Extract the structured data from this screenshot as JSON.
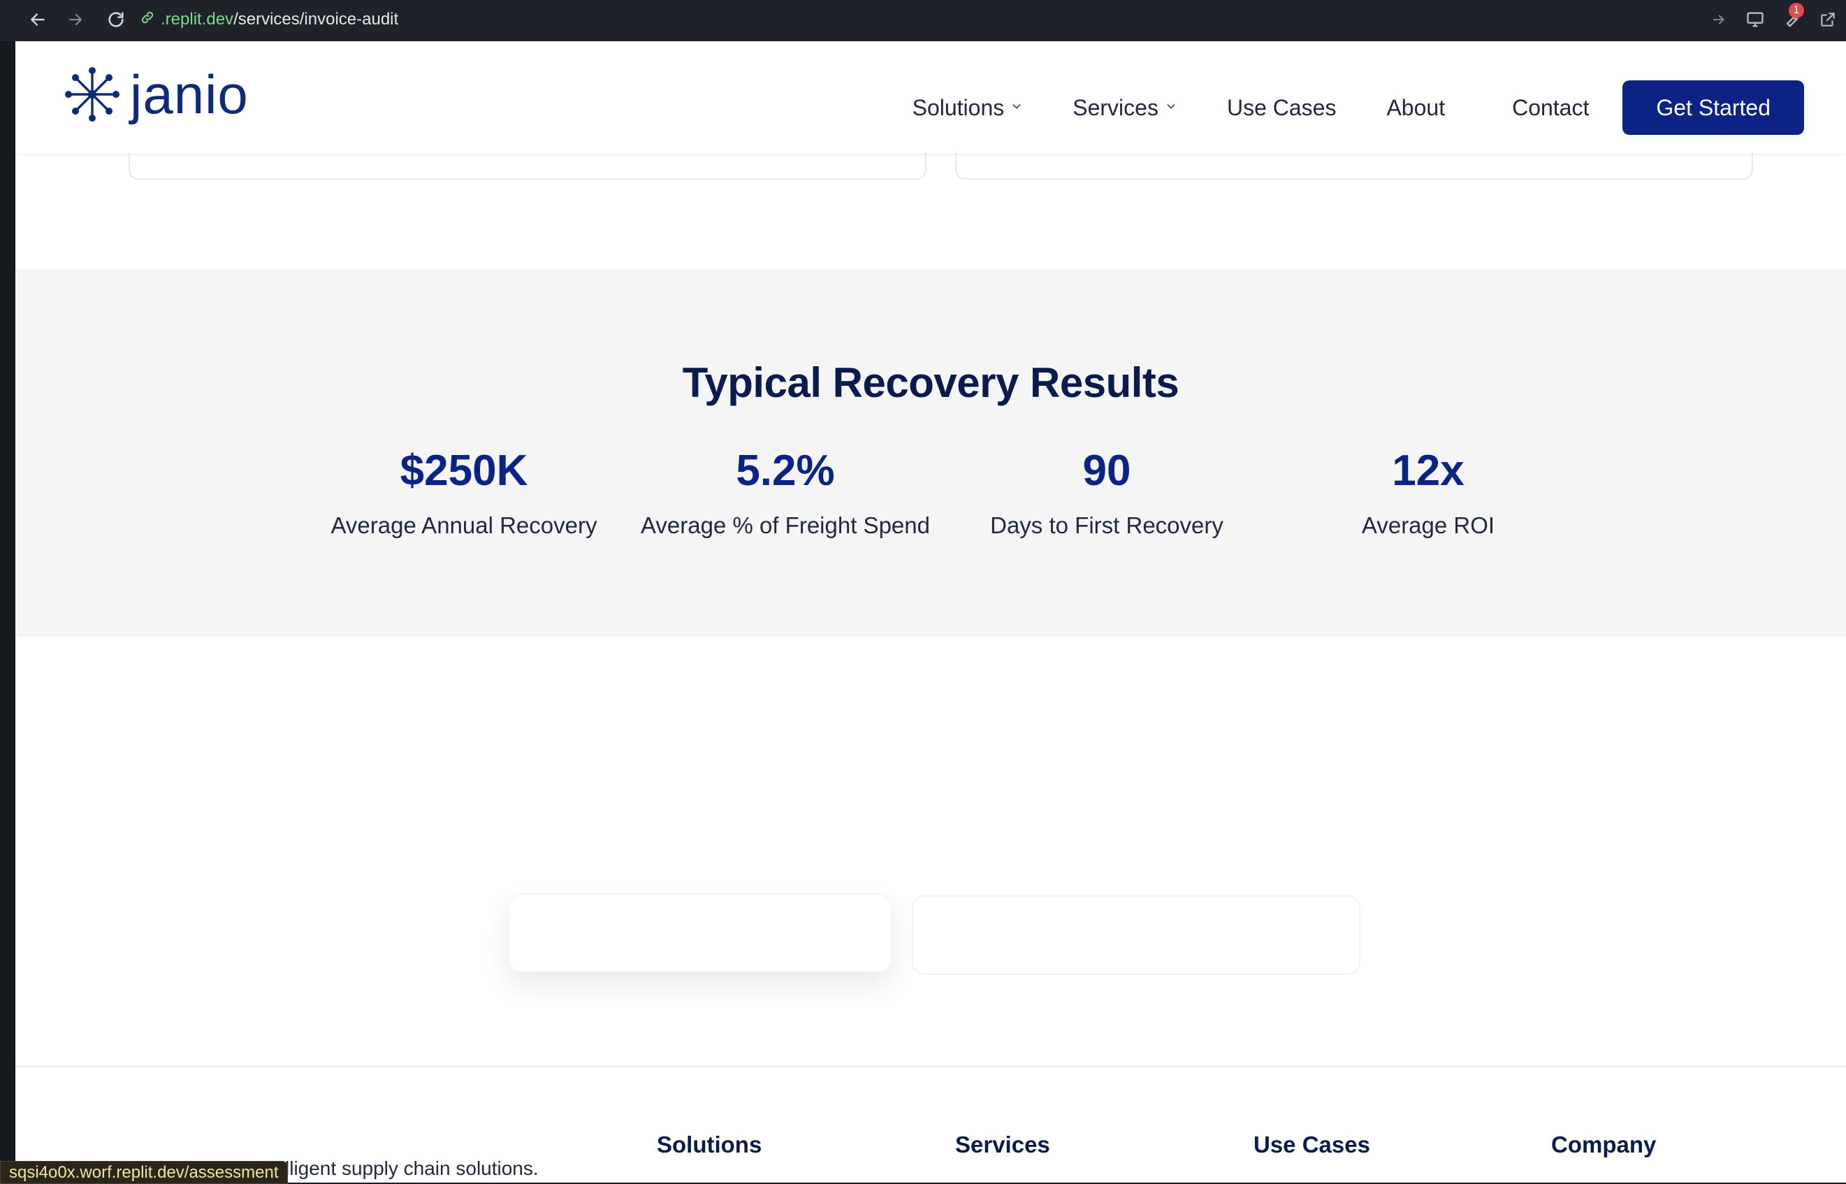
{
  "browser": {
    "url_domain": ".replit.dev",
    "url_path": "/services/invoice-audit",
    "badge_count": "1",
    "status_link": "sqsi4o0x.worf.replit.dev/assessment"
  },
  "header": {
    "logo_text": "janio",
    "nav": [
      {
        "label": "Solutions",
        "has_dropdown": true
      },
      {
        "label": "Services",
        "has_dropdown": true
      },
      {
        "label": "Use Cases",
        "has_dropdown": false
      },
      {
        "label": "About",
        "has_dropdown": false
      },
      {
        "label": "Contact",
        "has_dropdown": false
      }
    ],
    "cta_label": "Get Started",
    "brand_color": "#0b2384"
  },
  "results": {
    "title": "Typical Recovery Results",
    "stats": [
      {
        "value": "$250K",
        "label": "Average Annual Recovery"
      },
      {
        "value": "5.2%",
        "label": "Average % of Freight Spend"
      },
      {
        "value": "90",
        "label": "Days to First Recovery"
      },
      {
        "value": "12x",
        "label": "Average ROI"
      }
    ]
  },
  "footer": {
    "tagline_fragment": "lligent supply chain solutions.",
    "columns": [
      "Solutions",
      "Services",
      "Use Cases",
      "Company"
    ]
  }
}
